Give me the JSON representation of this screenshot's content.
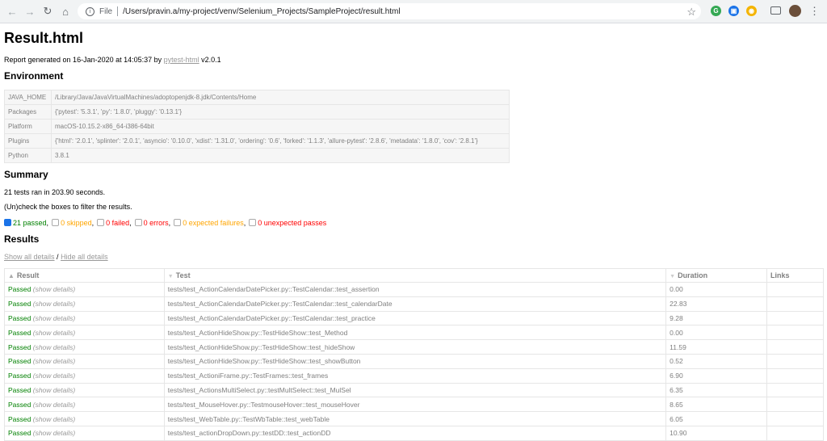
{
  "browser": {
    "back_icon": "←",
    "forward_icon": "→",
    "reload_icon": "↻",
    "home_icon": "⌂",
    "info_icon": "i",
    "file_label": "File",
    "url": "/Users/pravin.a/my-project/venv/Selenium_Projects/SampleProject/result.html",
    "star_icon": "☆",
    "ext_labels": [
      "G",
      "▣",
      "◉"
    ],
    "ext_colors": [
      "#34a853",
      "#1a73e8",
      "#f4b400"
    ],
    "menu_icon": "⋮"
  },
  "report": {
    "title": "Result.html",
    "generated_prefix": "Report generated on 16-Jan-2020 at 14:05:37 by ",
    "generator_link": "pytest-html",
    "generator_version": " v2.0.1"
  },
  "environment": {
    "heading": "Environment",
    "rows": [
      {
        "key": "JAVA_HOME",
        "value": "/Library/Java/JavaVirtualMachines/adoptopenjdk-8.jdk/Contents/Home"
      },
      {
        "key": "Packages",
        "value": "{'pytest': '5.3.1', 'py': '1.8.0', 'pluggy': '0.13.1'}"
      },
      {
        "key": "Platform",
        "value": "macOS-10.15.2-x86_64-i386-64bit"
      },
      {
        "key": "Plugins",
        "value": "{'html': '2.0.1', 'splinter': '2.0.1', 'asyncio': '0.10.0', 'xdist': '1.31.0', 'ordering': '0.6', 'forked': '1.1.3', 'allure-pytest': '2.8.6', 'metadata': '1.8.0', 'cov': '2.8.1'}"
      },
      {
        "key": "Python",
        "value": "3.8.1"
      }
    ]
  },
  "summary": {
    "heading": "Summary",
    "ran_text": "21 tests ran in 203.90 seconds.",
    "filter_hint": "(Un)check the boxes to filter the results.",
    "filters": [
      {
        "label": "21 passed",
        "checked": true,
        "cls": "passed"
      },
      {
        "label": "0 skipped",
        "checked": false,
        "cls": "skipped"
      },
      {
        "label": "0 failed",
        "checked": false,
        "cls": "failed"
      },
      {
        "label": "0 errors",
        "checked": false,
        "cls": "failed"
      },
      {
        "label": "0 expected failures",
        "checked": false,
        "cls": "skipped"
      },
      {
        "label": "0 unexpected passes",
        "checked": false,
        "cls": "failed"
      }
    ]
  },
  "results": {
    "heading": "Results",
    "show_all": "Show all details",
    "separator": " / ",
    "hide_all": "Hide all details",
    "columns": [
      "Result",
      "Test",
      "Duration",
      "Links"
    ],
    "sort_icons": {
      "asc": "▲",
      "desc": "▼"
    },
    "rows": [
      {
        "result": "Passed",
        "details": "(show details)",
        "test": "tests/test_ActionCalendarDatePicker.py::TestCalendar::test_assertion",
        "duration": "0.00"
      },
      {
        "result": "Passed",
        "details": "(show details)",
        "test": "tests/test_ActionCalendarDatePicker.py::TestCalendar::test_calendarDate",
        "duration": "22.83"
      },
      {
        "result": "Passed",
        "details": "(show details)",
        "test": "tests/test_ActionCalendarDatePicker.py::TestCalendar::test_practice",
        "duration": "9.28"
      },
      {
        "result": "Passed",
        "details": "(show details)",
        "test": "tests/test_ActionHideShow.py::TestHideShow::test_Method",
        "duration": "0.00"
      },
      {
        "result": "Passed",
        "details": "(show details)",
        "test": "tests/test_ActionHideShow.py::TestHideShow::test_hideShow",
        "duration": "11.59"
      },
      {
        "result": "Passed",
        "details": "(show details)",
        "test": "tests/test_ActionHideShow.py::TestHideShow::test_showButton",
        "duration": "0.52"
      },
      {
        "result": "Passed",
        "details": "(show details)",
        "test": "tests/test_ActioniFrame.py::TestFrames::test_frames",
        "duration": "6.90"
      },
      {
        "result": "Passed",
        "details": "(show details)",
        "test": "tests/test_ActionsMultiSelect.py::testMultSelect::test_MulSel",
        "duration": "6.35"
      },
      {
        "result": "Passed",
        "details": "(show details)",
        "test": "tests/test_MouseHover.py::TestmouseHover::test_mouseHover",
        "duration": "8.65"
      },
      {
        "result": "Passed",
        "details": "(show details)",
        "test": "tests/test_WebTable.py::TestWbTable::test_webTable",
        "duration": "6.05"
      },
      {
        "result": "Passed",
        "details": "(show details)",
        "test": "tests/test_actionDropDown.py::testDD::test_actionDD",
        "duration": "10.90"
      }
    ]
  }
}
